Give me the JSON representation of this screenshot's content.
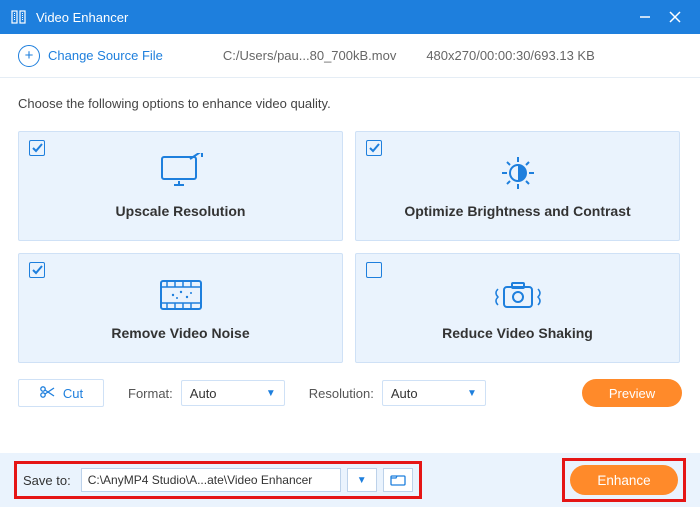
{
  "window": {
    "title": "Video Enhancer"
  },
  "toolbar": {
    "change_source_label": "Change Source File",
    "file_path": "C:/Users/pau...80_700kB.mov",
    "file_meta": "480x270/00:00:30/693.13 KB"
  },
  "instruction": "Choose the following options to enhance video quality.",
  "options": {
    "upscale": {
      "label": "Upscale Resolution",
      "checked": true
    },
    "brightness": {
      "label": "Optimize Brightness and Contrast",
      "checked": true
    },
    "noise": {
      "label": "Remove Video Noise",
      "checked": true
    },
    "shaking": {
      "label": "Reduce Video Shaking",
      "checked": false
    }
  },
  "controls": {
    "cut_label": "Cut",
    "format_label": "Format:",
    "format_value": "Auto",
    "resolution_label": "Resolution:",
    "resolution_value": "Auto",
    "preview_label": "Preview"
  },
  "save": {
    "label": "Save to:",
    "path": "C:\\AnyMP4 Studio\\A...ate\\Video Enhancer"
  },
  "enhance_label": "Enhance"
}
